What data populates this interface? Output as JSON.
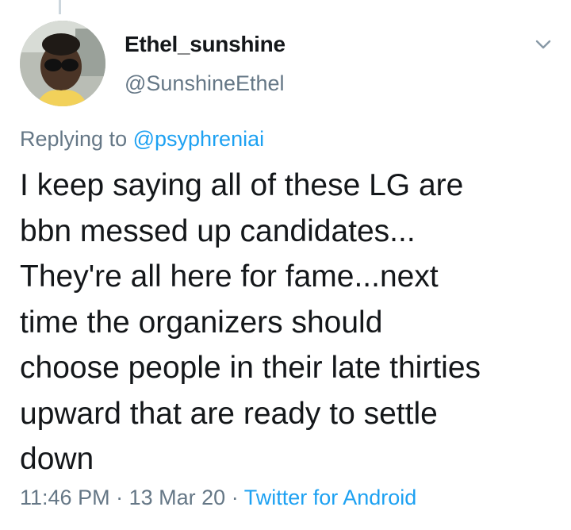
{
  "tweet": {
    "author": {
      "display_name": "Ethel_sunshine",
      "handle": "@SunshineEthel",
      "avatar_icon": "user-avatar-photo"
    },
    "menu_icon": "chevron-down-icon",
    "replying_to_label": "Replying to",
    "replying_to_handle": "@psyphreniai",
    "text": "I keep saying all of these LG are\nbbn messed up candidates...\nThey're all here for fame...next\ntime the organizers should\nchoose people in their late thirties\nupward that are ready to settle\ndown",
    "time": "11:46 PM",
    "separator": "·",
    "date": "13 Mar 20",
    "source": "Twitter for Android"
  },
  "colors": {
    "text_primary": "#14171a",
    "text_secondary": "#657786",
    "link": "#1da1f2",
    "thread_line": "#ccd6dd"
  }
}
